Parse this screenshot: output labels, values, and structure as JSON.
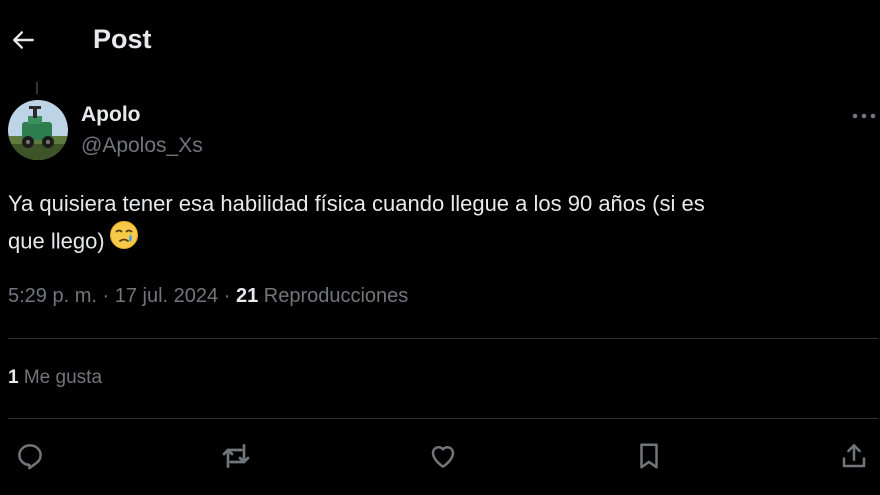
{
  "header": {
    "title": "Post"
  },
  "post": {
    "author_name": "Apolo",
    "author_handle": "@Apolos_Xs",
    "text_line1": "Ya quisiera tener esa habilidad física cuando llegue a los 90 años (si es",
    "text_line2": "que llego)",
    "time": "5:29 p. m.",
    "separator": "·",
    "date": "17 jul. 2024",
    "views_count": "21",
    "views_label": "Reproducciones",
    "likes_count": "1",
    "likes_label": "Me gusta"
  },
  "icons": {
    "back": "arrow-left-icon",
    "more": "more-horizontal-icon",
    "emoji": "crying-face-emoji",
    "actions": [
      "reply-icon",
      "retweet-icon",
      "like-icon",
      "bookmark-icon",
      "share-icon"
    ]
  },
  "colors": {
    "background": "#000000",
    "text": "#e7e9ea",
    "secondary_text": "#71767b",
    "divider": "#2f3336"
  }
}
